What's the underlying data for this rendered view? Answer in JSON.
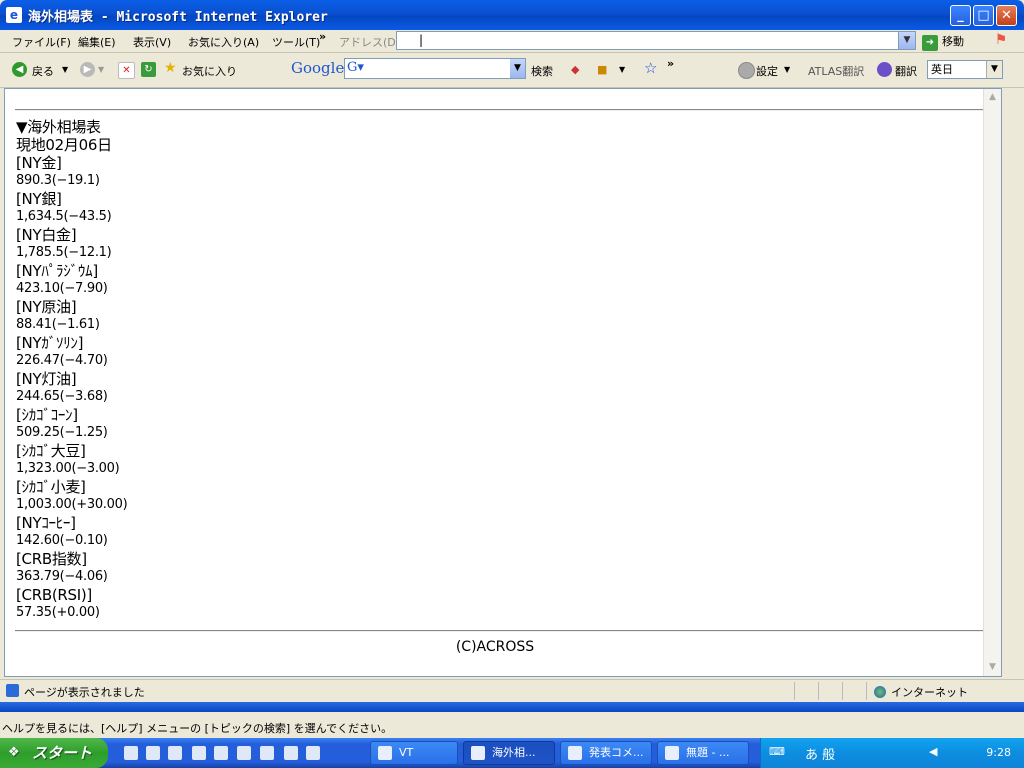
{
  "window": {
    "title": "海外相場表 - Microsoft Internet Explorer"
  },
  "menubar": {
    "items": [
      "ファイル(F)",
      "編集(E)",
      "表示(V)",
      "お気に入り(A)",
      "ツール(T)"
    ],
    "more": "»",
    "address_label": "アドレス(D)",
    "address_value": "|",
    "go_label": "移動"
  },
  "toolbar": {
    "back_label": "戻る",
    "favorites_label": "お気に入り",
    "google_label": "Google",
    "search_label": "検索",
    "settings_label": "設定",
    "atlas_label": "ATLAS翻訳",
    "translate_label": "翻訳",
    "language_value": "英日"
  },
  "page": {
    "heading": "▼海外相場表",
    "date": "現地02月06日",
    "quotes": [
      {
        "name": "[NY金]",
        "value": "890.3(−19.1)"
      },
      {
        "name": "[NY銀]",
        "value": "1,634.5(−43.5)"
      },
      {
        "name": "[NY白金]",
        "value": "1,785.5(−12.1)"
      },
      {
        "name": "[NYﾊﾟﾗｼﾞｳﾑ]",
        "value": "423.10(−7.90)"
      },
      {
        "name": "[NY原油]",
        "value": "88.41(−1.61)"
      },
      {
        "name": "[NYｶﾞｿﾘﾝ]",
        "value": "226.47(−4.70)"
      },
      {
        "name": "[NY灯油]",
        "value": "244.65(−3.68)"
      },
      {
        "name": "[ｼｶｺﾞｺｰﾝ]",
        "value": "509.25(−1.25)"
      },
      {
        "name": "[ｼｶｺﾞ大豆]",
        "value": "1,323.00(−3.00)"
      },
      {
        "name": "[ｼｶｺﾞ小麦]",
        "value": "1,003.00(+30.00)"
      },
      {
        "name": "[NYｺｰﾋｰ]",
        "value": "142.60(−0.10)"
      },
      {
        "name": "[CRB指数]",
        "value": "363.79(−4.06)"
      },
      {
        "name": "[CRB(RSI)]",
        "value": "57.35(+0.00)"
      }
    ],
    "copyright": "(C)ACROSS"
  },
  "statusbar": {
    "text": "ページが表示されました",
    "zone": "インターネット"
  },
  "helpbar": {
    "text": "ヘルプを見るには、[ヘルプ] メニューの [トピックの検索] を選んでください。"
  },
  "taskbar": {
    "start_label": "スタート",
    "tasks": [
      {
        "label": "VT"
      },
      {
        "label": "海外相..."
      },
      {
        "label": "発表コメ..."
      },
      {
        "label": "無題 - ..."
      }
    ],
    "ime_text": "あ 般",
    "clock": "9:28"
  }
}
